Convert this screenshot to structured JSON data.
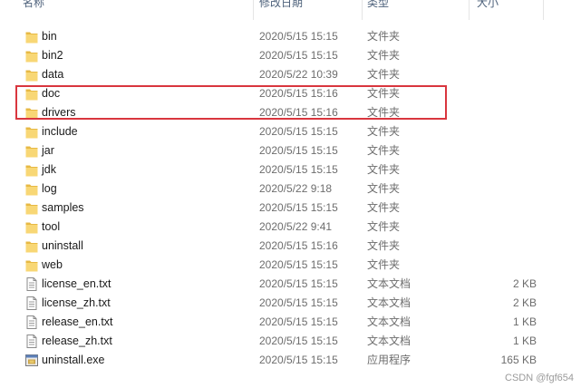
{
  "header": {
    "name": "名称",
    "date": "修改日期",
    "type": "类型",
    "size": "大小"
  },
  "items": [
    {
      "name": "bin",
      "date": "2020/5/15 15:15",
      "type": "文件夹",
      "size": "",
      "icon": "folder-icon"
    },
    {
      "name": "bin2",
      "date": "2020/5/15 15:15",
      "type": "文件夹",
      "size": "",
      "icon": "folder-icon"
    },
    {
      "name": "data",
      "date": "2020/5/22 10:39",
      "type": "文件夹",
      "size": "",
      "icon": "folder-icon"
    },
    {
      "name": "doc",
      "date": "2020/5/15 15:16",
      "type": "文件夹",
      "size": "",
      "icon": "folder-icon"
    },
    {
      "name": "drivers",
      "date": "2020/5/15 15:16",
      "type": "文件夹",
      "size": "",
      "icon": "folder-icon"
    },
    {
      "name": "include",
      "date": "2020/5/15 15:15",
      "type": "文件夹",
      "size": "",
      "icon": "folder-icon"
    },
    {
      "name": "jar",
      "date": "2020/5/15 15:15",
      "type": "文件夹",
      "size": "",
      "icon": "folder-icon"
    },
    {
      "name": "jdk",
      "date": "2020/5/15 15:15",
      "type": "文件夹",
      "size": "",
      "icon": "folder-icon"
    },
    {
      "name": "log",
      "date": "2020/5/22 9:18",
      "type": "文件夹",
      "size": "",
      "icon": "folder-icon"
    },
    {
      "name": "samples",
      "date": "2020/5/15 15:15",
      "type": "文件夹",
      "size": "",
      "icon": "folder-icon"
    },
    {
      "name": "tool",
      "date": "2020/5/22 9:41",
      "type": "文件夹",
      "size": "",
      "icon": "folder-icon"
    },
    {
      "name": "uninstall",
      "date": "2020/5/15 15:16",
      "type": "文件夹",
      "size": "",
      "icon": "folder-icon"
    },
    {
      "name": "web",
      "date": "2020/5/15 15:15",
      "type": "文件夹",
      "size": "",
      "icon": "folder-icon"
    },
    {
      "name": "license_en.txt",
      "date": "2020/5/15 15:15",
      "type": "文本文档",
      "size": "2 KB",
      "icon": "text-file-icon"
    },
    {
      "name": "license_zh.txt",
      "date": "2020/5/15 15:15",
      "type": "文本文档",
      "size": "2 KB",
      "icon": "text-file-icon"
    },
    {
      "name": "release_en.txt",
      "date": "2020/5/15 15:15",
      "type": "文本文档",
      "size": "1 KB",
      "icon": "text-file-icon"
    },
    {
      "name": "release_zh.txt",
      "date": "2020/5/15 15:15",
      "type": "文本文档",
      "size": "1 KB",
      "icon": "text-file-icon"
    },
    {
      "name": "uninstall.exe",
      "date": "2020/5/15 15:15",
      "type": "应用程序",
      "size": "165 KB",
      "icon": "exe-icon"
    }
  ],
  "highlight": {
    "color": "#d9363e",
    "rows": [
      "doc",
      "drivers"
    ]
  },
  "watermark": "CSDN @fgf654",
  "colors": {
    "folder": "#f8d775",
    "folder_dark": "#e7b944",
    "header_text": "#4c607a",
    "meta_text": "#6d6d6d"
  }
}
